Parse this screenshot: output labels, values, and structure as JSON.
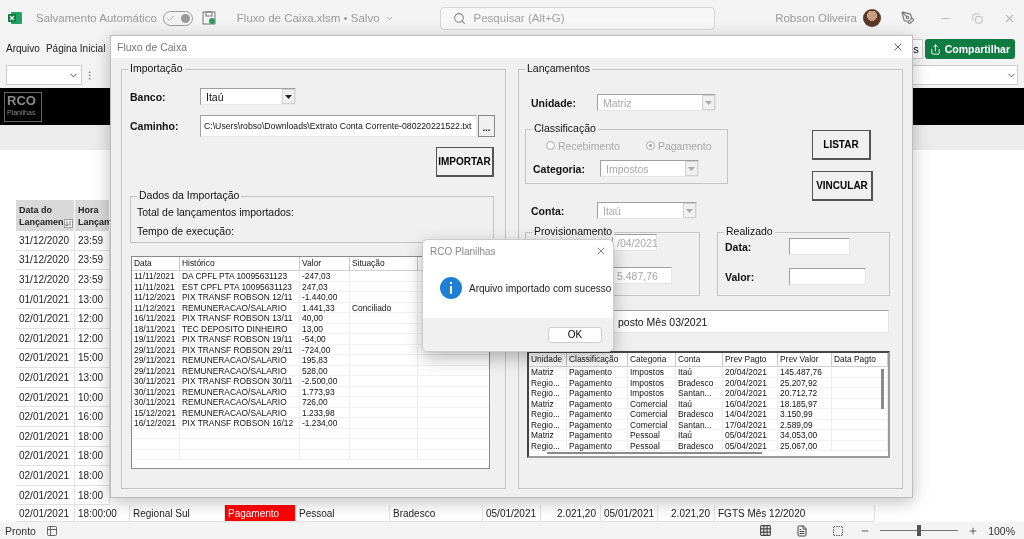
{
  "excel": {
    "autosave_label": "Salvamento Automático",
    "autosave_on": true,
    "file_title": "Fluxo de Caixa.xlsm • Salvo",
    "search_placeholder": "Pesquisar (Alt+G)",
    "user_name": "Robson Oliveira",
    "ribbon_tabs": [
      {
        "label": "Arquivo",
        "selected": false
      },
      {
        "label": "Página Inicial",
        "selected": false
      }
    ],
    "ribbon_button_partial": "s",
    "share_button": "Compartilhar",
    "logo": {
      "main": "RCO",
      "sub": "Planilhas"
    },
    "sheet": {
      "headers": [
        {
          "lines": [
            "Data do",
            "Lançamen"
          ],
          "filter_button": true
        },
        {
          "lines": [
            "Hora",
            "Lançam"
          ],
          "filter_button": false
        }
      ],
      "rows": [
        {
          "cells": [
            "31/12/2020",
            "23:59"
          ]
        },
        {
          "cells": [
            "31/12/2020",
            "23:59"
          ]
        },
        {
          "cells": [
            "31/12/2020",
            "23:59"
          ]
        },
        {
          "cells": [
            "01/01/2021",
            "13:00"
          ]
        },
        {
          "cells": [
            "02/01/2021",
            "12:00"
          ]
        },
        {
          "cells": [
            "02/01/2021",
            "12:00"
          ]
        },
        {
          "cells": [
            "02/01/2021",
            "15:00"
          ]
        },
        {
          "cells": [
            "02/01/2021",
            "13:00"
          ]
        },
        {
          "cells": [
            "02/01/2021",
            "10:00"
          ]
        },
        {
          "cells": [
            "02/01/2021",
            "16:00"
          ]
        },
        {
          "cells": [
            "02/01/2021",
            "18:00"
          ]
        },
        {
          "cells": [
            "02/01/2021",
            "18:00"
          ]
        },
        {
          "cells": [
            "02/01/2021",
            "18:00"
          ]
        },
        {
          "cells": [
            "02/01/2021",
            "18:00"
          ]
        },
        {
          "cells": [
            "02/01/2021",
            "18:00:00",
            "Regional Sul",
            "Pagamento",
            "Pessoal",
            "Bradesco",
            "05/01/2021",
            "2.021,20",
            "05/01/2021",
            "2.021,20",
            "FGTS Mês 12/2020"
          ],
          "alert": true
        }
      ]
    },
    "status": "Pronto",
    "zoom": {
      "label": "100%",
      "level": 0.5
    }
  },
  "form": {
    "title": "Fluxo de Caixa",
    "import": {
      "title": "Importação",
      "bank": {
        "label": "Banco:",
        "value": "Itaú",
        "disabled": false
      },
      "path_label": "Caminho:",
      "path": "C:\\Users\\robso\\Downloads\\Extrato Conta Corrente-080220221522.txt",
      "browse_button": "...",
      "import_button": "IMPORTAR",
      "summary": {
        "title": "Dados da Importação",
        "total_label": "Total de lançamentos importados:",
        "time_label": "Tempo de execução:"
      },
      "list": {
        "columns": [
          "Data",
          "Histórico",
          "Valor",
          "Situação"
        ],
        "rows": [
          [
            "11/11/2021",
            "DA  CPFL PTA 10095631123",
            "-247,03"
          ],
          [
            "11/11/2021",
            "EST CPFL PTA 10095631123",
            "247,03"
          ],
          [
            "11/12/2021",
            "PIX TRANSF  ROBSON 12/11",
            "-1.440,00"
          ],
          [
            "11/12/2021",
            "REMUNERACAO/SALARIO",
            "1.441,33",
            "Conciliado"
          ],
          [
            "16/11/2021",
            "PIX TRANSF  ROBSON 13/11",
            "40,00"
          ],
          [
            "18/11/2021",
            "TEC DEPOSITO DINHEIRO",
            "13,00"
          ],
          [
            "19/11/2021",
            "PIX TRANSF  ROBSON 19/11",
            "-54,00"
          ],
          [
            "29/11/2021",
            "PIX TRANSF  ROBSON 29/11",
            "-724,00"
          ],
          [
            "29/11/2021",
            "REMUNERACAO/SALARIO",
            "195,83"
          ],
          [
            "29/11/2021",
            "REMUNERACAO/SALARIO",
            "528,00"
          ],
          [
            "30/11/2021",
            "PIX TRANSF  ROBSON 30/11",
            "-2.500,00"
          ],
          [
            "30/11/2021",
            "REMUNERACAO/SALARIO",
            "1.773,93"
          ],
          [
            "30/11/2021",
            "REMUNERACAO/SALARIO",
            "726,00"
          ],
          [
            "15/12/2021",
            "REMUNERACAO/SALARIO",
            "1.233,98"
          ],
          [
            "16/12/2021",
            "PIX TRANSF  ROBSON 16/12",
            "-1.234,00"
          ]
        ]
      }
    },
    "entries": {
      "title": "Lançamentos",
      "unit": {
        "label": "Unidade:",
        "value": "Matriz",
        "disabled": true
      },
      "classification": {
        "title": "Classificação",
        "options": [
          {
            "label": "Recebimento",
            "selected": false
          },
          {
            "label": "Pagamento",
            "selected": true
          }
        ],
        "disabled": true,
        "category": {
          "label": "Categoria:",
          "value": "Impostos",
          "disabled": true
        }
      },
      "list_button": "LISTAR",
      "link_button": "VINCULAR",
      "account": {
        "label": "Conta:",
        "value": "Itaú",
        "disabled": true
      },
      "provision": {
        "title": "Provisionamento",
        "date": "/04/2021",
        "amount": "5.487,76"
      },
      "realized": {
        "title": "Realizado",
        "date_label": "Data:",
        "amount_label": "Valor:"
      },
      "description": "posto Mês 03/2021",
      "list": {
        "columns": [
          "Unidade",
          "Classificação",
          "Categoria",
          "Conta",
          "Prev Pagto",
          "Prev Valor",
          "Data Pagto"
        ],
        "rows": [
          [
            "Matriz",
            "Pagamento",
            "Impostos",
            "Itaú",
            "20/04/2021",
            "145.487,76"
          ],
          [
            "Regio...",
            "Pagamento",
            "Impostos",
            "Bradesco",
            "20/04/2021",
            "25.207,92"
          ],
          [
            "Regio...",
            "Pagamento",
            "Impostos",
            "Santan...",
            "20/04/2021",
            "20.712,72"
          ],
          [
            "Matriz",
            "Pagamento",
            "Comercial",
            "Itaú",
            "16/04/2021",
            "18.185,97"
          ],
          [
            "Regio...",
            "Pagamento",
            "Comercial",
            "Bradesco",
            "14/04/2021",
            "3.150,99"
          ],
          [
            "Regio...",
            "Pagamento",
            "Comercial",
            "Santan...",
            "17/04/2021",
            "2.589,09"
          ],
          [
            "Matriz",
            "Pagamento",
            "Pessoal",
            "Itaú",
            "05/04/2021",
            "34.053,00"
          ],
          [
            "Regio...",
            "Pagamento",
            "Pessoal",
            "Bradesco",
            "05/04/2021",
            "25.067,00"
          ]
        ]
      }
    }
  },
  "message_box": {
    "title": "RCO Planilhas",
    "text": "Arquivo importado com sucesso",
    "button": "OK"
  }
}
